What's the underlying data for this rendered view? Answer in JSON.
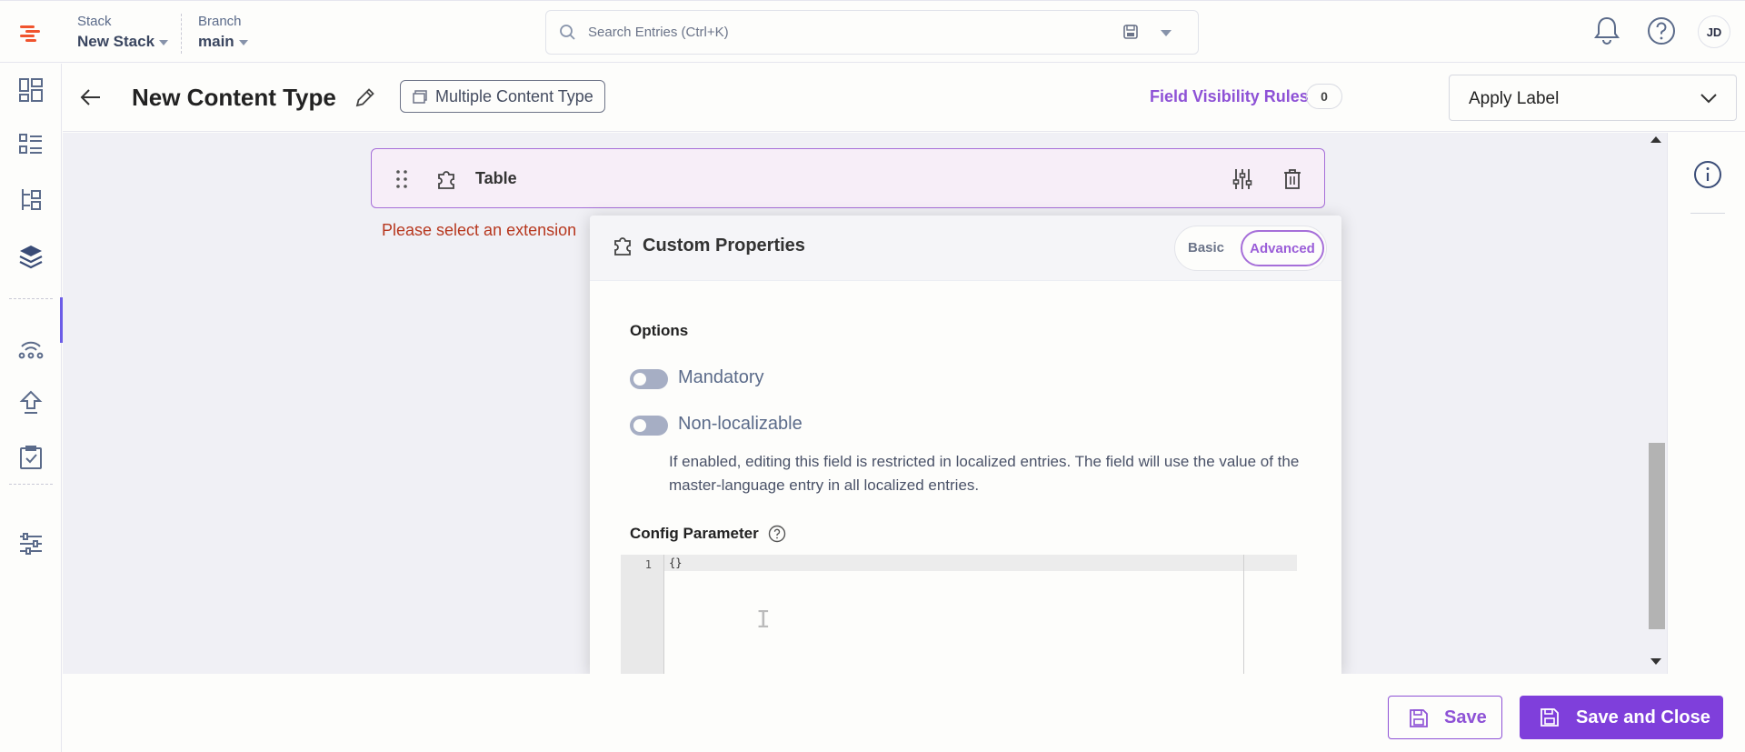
{
  "header": {
    "stack_label": "Stack",
    "stack_value": "New Stack",
    "branch_label": "Branch",
    "branch_value": "main",
    "search_placeholder": "Search Entries (Ctrl+K)",
    "avatar_initials": "JD"
  },
  "subheader": {
    "title": "New Content Type",
    "type_chip": "Multiple Content Type",
    "field_visibility_label": "Field Visibility Rules",
    "field_visibility_count": "0",
    "apply_label": "Apply Label"
  },
  "field": {
    "name": "Table",
    "error": "Please select an extension"
  },
  "modal": {
    "title": "Custom Properties",
    "tab_basic": "Basic",
    "tab_advanced": "Advanced",
    "options_heading": "Options",
    "mandatory_label": "Mandatory",
    "mandatory_on": false,
    "non_localizable_label": "Non-localizable",
    "non_localizable_on": false,
    "non_localizable_help": "If enabled, editing this field is restricted in localized entries. The field will use the value of the master-language entry in all localized entries.",
    "config_heading": "Config Parameter",
    "editor_line_number": "1",
    "editor_code": "{}"
  },
  "footer": {
    "save_label": "Save",
    "save_close_label": "Save and Close"
  },
  "colors": {
    "accent": "#7f3fdb",
    "accent_text": "#8e52d6",
    "error": "#b7381f",
    "brand_logo": "#f0542e"
  }
}
